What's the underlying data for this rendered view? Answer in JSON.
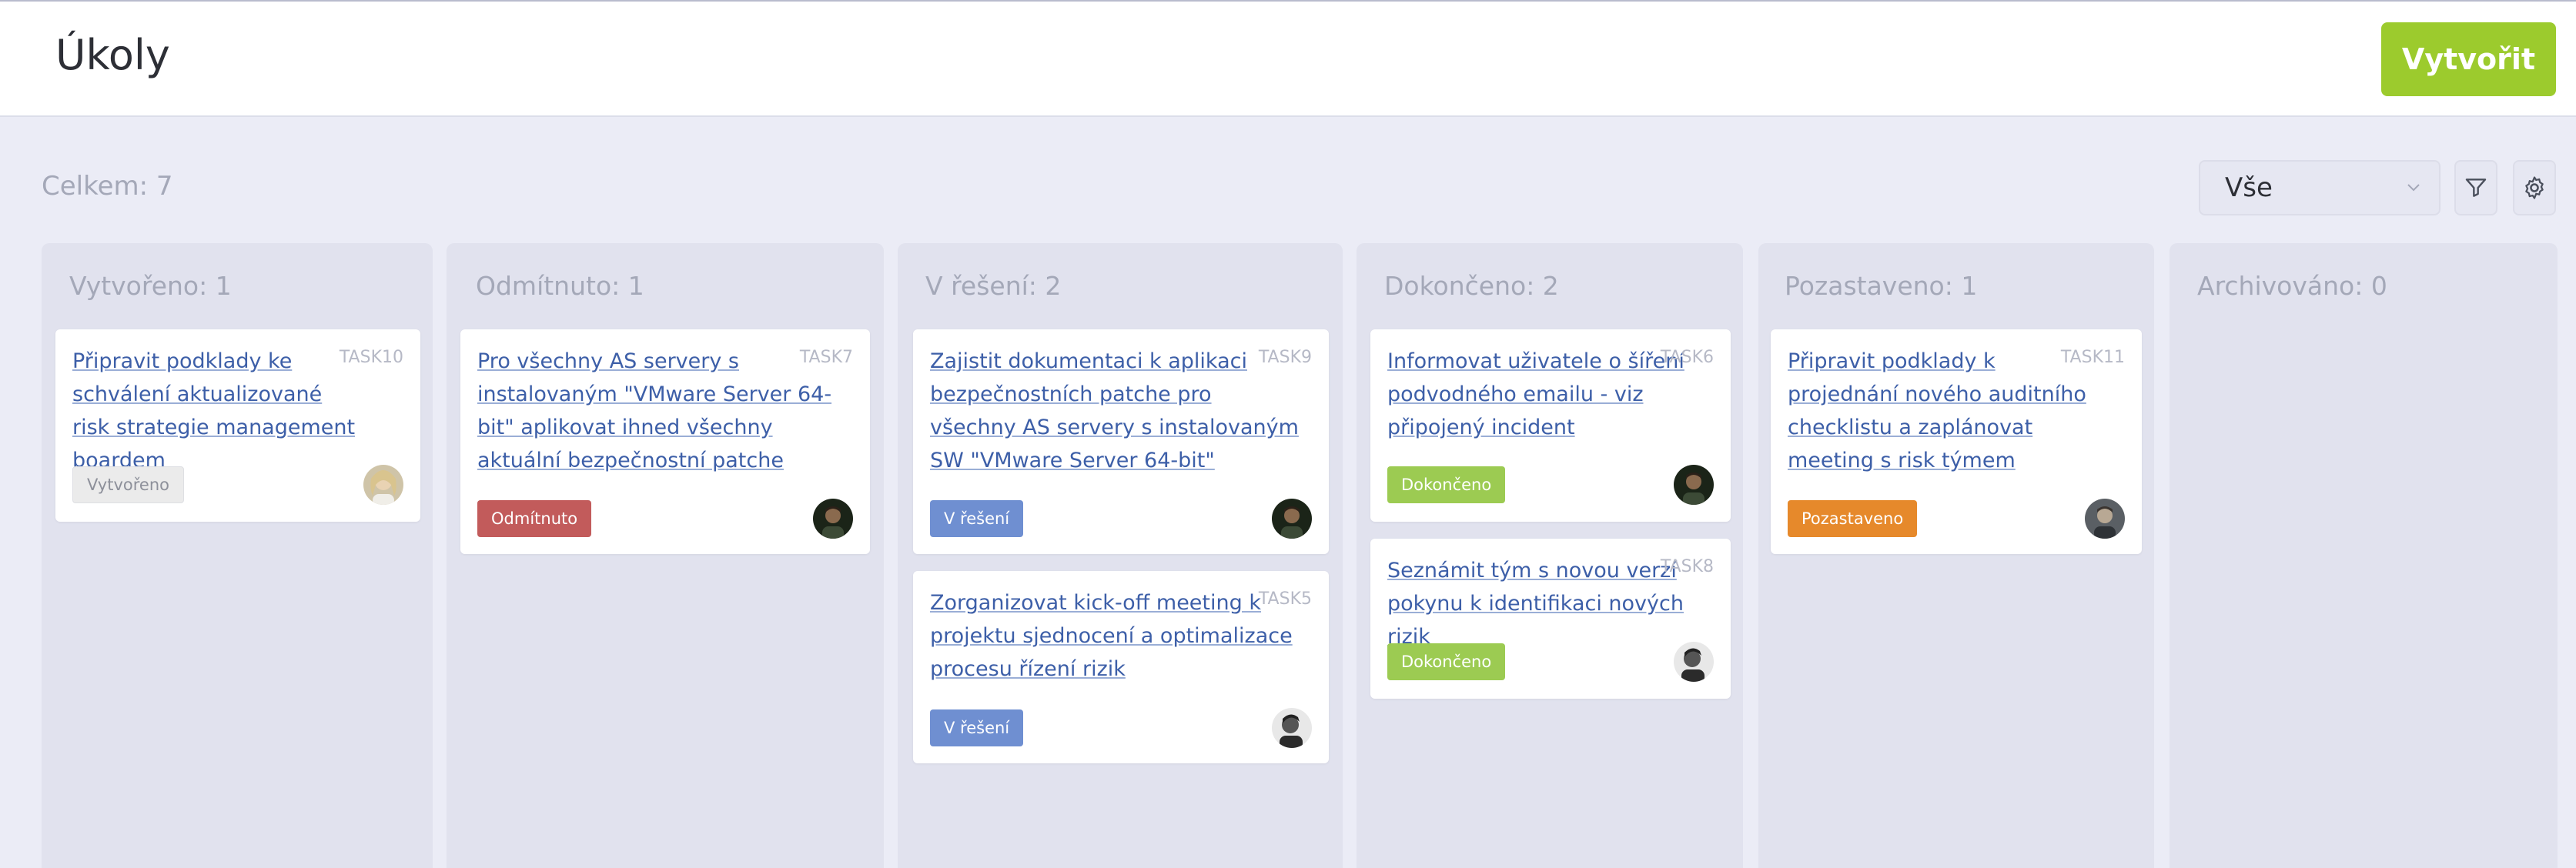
{
  "header": {
    "title": "Úkoly",
    "create_label": "Vytvořit"
  },
  "toolbar": {
    "total_label": "Celkem: 7",
    "filter_value": "Vše",
    "filter_icon": "filter-icon",
    "settings_icon": "gear-icon"
  },
  "colors": {
    "accent": "#9ccb2d",
    "link": "#3d5fa8",
    "created": "#ebebeb",
    "rejected": "#c25b5b",
    "in_progress": "#6f8fd1",
    "done": "#9ccb52",
    "paused": "#e6892b"
  },
  "columns": [
    {
      "title": "Vytvořeno: 1",
      "cards": [
        {
          "title": "Připravit podklady ke schválení aktualizované risk strategie management boardem",
          "id": "TASK10",
          "status": "Vytvořeno"
        }
      ]
    },
    {
      "title": "Odmítnuto: 1",
      "cards": [
        {
          "title": "Pro všechny AS servery s instalovaným \"VMware Server 64-bit\" aplikovat ihned všechny aktuální bezpečnostní patche",
          "id": "TASK7",
          "status": "Odmítnuto"
        }
      ]
    },
    {
      "title": "V řešení: 2",
      "cards": [
        {
          "title": "Zajistit dokumentaci k aplikaci bezpečnostních patche pro všechny AS servery s instalovaným SW \"VMware Server 64-bit\"",
          "id": "TASK9",
          "status": "V řešení"
        },
        {
          "title": "Zorganizovat kick-off meeting k projektu sjednocení a optimalizace procesu řízení rizik",
          "id": "TASK5",
          "status": "V řešení"
        }
      ]
    },
    {
      "title": "Dokončeno: 2",
      "cards": [
        {
          "title": "Informovat uživatele o šíření podvodného emailu - viz připojený incident",
          "id": "TASK6",
          "status": "Dokončeno"
        },
        {
          "title": "Seznámit tým s novou verzí pokynu k identifikaci nových rizik",
          "id": "TASK8",
          "status": "Dokončeno"
        }
      ]
    },
    {
      "title": "Pozastaveno: 1",
      "cards": [
        {
          "title": "Připravit podklady k projednání nového auditního checklistu a zaplánovat meeting s risk týmem",
          "id": "TASK11",
          "status": "Pozastaveno"
        }
      ]
    },
    {
      "title": "Archivováno: 0",
      "cards": []
    }
  ]
}
